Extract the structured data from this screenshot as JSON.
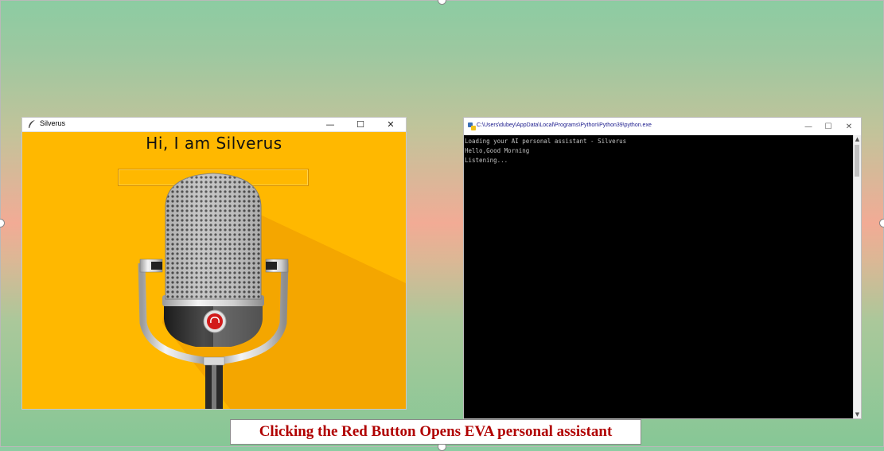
{
  "colors": {
    "app_background": "#ffb800",
    "caption_text": "#b00000",
    "console_background": "#000000",
    "console_text": "#c0c0c0"
  },
  "left_window": {
    "title": "Silverus",
    "minimize_icon": "—",
    "maximize_icon": "☐",
    "close_icon": "✕",
    "greeting": "Hi, I am Silverus",
    "input_value": "",
    "input_placeholder": ""
  },
  "right_window": {
    "title": "C:\\Users\\dubey\\AppData\\Local\\Programs\\Python\\Python39\\python.exe",
    "minimize_icon": "—",
    "maximize_icon": "☐",
    "close_icon": "✕",
    "console_lines": [
      "Loading your AI personal assistant - Silverus",
      "Hello,Good Morning",
      "Listening..."
    ]
  },
  "caption": {
    "text": "Clicking the Red Button Opens EVA personal assistant"
  }
}
